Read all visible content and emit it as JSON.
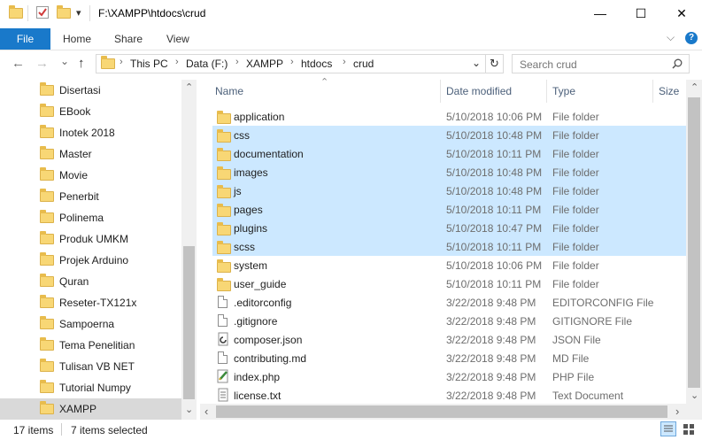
{
  "window": {
    "title": "F:\\XAMPP\\htdocs\\crud",
    "minimize_glyph": "—",
    "maximize_glyph": "☐",
    "close_glyph": "✕"
  },
  "quick_access": {
    "folder_icon": "folder-icon",
    "properties_icon": "properties-check-icon",
    "new_folder_icon": "new-folder-icon",
    "dropdown_glyph": "▾"
  },
  "ribbon": {
    "tabs": [
      "File",
      "Home",
      "Share",
      "View"
    ],
    "expand_glyph": "⌵",
    "help_glyph": "?"
  },
  "navigation": {
    "back_glyph": "←",
    "forward_glyph": "→",
    "recent_glyph": "⌄",
    "up_glyph": "↑",
    "breadcrumbs": [
      "This PC",
      "Data (F:)",
      "XAMPP",
      "htdocs",
      "crud"
    ],
    "separator": "›",
    "dropdown_glyph": "⌄",
    "refresh_glyph": "↻"
  },
  "search": {
    "placeholder": "Search crud",
    "icon": "search-icon"
  },
  "nav_pane": {
    "items": [
      {
        "label": "Disertasi",
        "selected": false
      },
      {
        "label": "EBook",
        "selected": false
      },
      {
        "label": "Inotek 2018",
        "selected": false
      },
      {
        "label": "Master",
        "selected": false
      },
      {
        "label": "Movie",
        "selected": false
      },
      {
        "label": "Penerbit",
        "selected": false
      },
      {
        "label": "Polinema",
        "selected": false
      },
      {
        "label": "Produk UMKM",
        "selected": false
      },
      {
        "label": "Projek Arduino",
        "selected": false
      },
      {
        "label": "Quran",
        "selected": false
      },
      {
        "label": "Reseter-TX121x",
        "selected": false
      },
      {
        "label": "Sampoerna",
        "selected": false
      },
      {
        "label": "Tema Penelitian",
        "selected": false
      },
      {
        "label": "Tulisan VB NET",
        "selected": false
      },
      {
        "label": "Tutorial Numpy",
        "selected": false
      },
      {
        "label": "XAMPP",
        "selected": true
      }
    ]
  },
  "file_list": {
    "columns": [
      "Name",
      "Date modified",
      "Type",
      "Size"
    ],
    "sort_glyph": "⌃",
    "rows": [
      {
        "name": "application",
        "date": "5/10/2018 10:06 PM",
        "type": "File folder",
        "icon": "folder-icon",
        "selected": false
      },
      {
        "name": "css",
        "date": "5/10/2018 10:48 PM",
        "type": "File folder",
        "icon": "folder-icon",
        "selected": true
      },
      {
        "name": "documentation",
        "date": "5/10/2018 10:11 PM",
        "type": "File folder",
        "icon": "folder-icon",
        "selected": true
      },
      {
        "name": "images",
        "date": "5/10/2018 10:48 PM",
        "type": "File folder",
        "icon": "folder-icon",
        "selected": true
      },
      {
        "name": "js",
        "date": "5/10/2018 10:48 PM",
        "type": "File folder",
        "icon": "folder-icon",
        "selected": true
      },
      {
        "name": "pages",
        "date": "5/10/2018 10:11 PM",
        "type": "File folder",
        "icon": "folder-icon",
        "selected": true
      },
      {
        "name": "plugins",
        "date": "5/10/2018 10:47 PM",
        "type": "File folder",
        "icon": "folder-icon",
        "selected": true
      },
      {
        "name": "scss",
        "date": "5/10/2018 10:11 PM",
        "type": "File folder",
        "icon": "folder-icon",
        "selected": true
      },
      {
        "name": "system",
        "date": "5/10/2018 10:06 PM",
        "type": "File folder",
        "icon": "folder-icon",
        "selected": false
      },
      {
        "name": "user_guide",
        "date": "5/10/2018 10:11 PM",
        "type": "File folder",
        "icon": "folder-icon",
        "selected": false
      },
      {
        "name": ".editorconfig",
        "date": "3/22/2018 9:48 PM",
        "type": "EDITORCONFIG File",
        "icon": "file-icon",
        "selected": false
      },
      {
        "name": ".gitignore",
        "date": "3/22/2018 9:48 PM",
        "type": "GITIGNORE File",
        "icon": "file-icon",
        "selected": false
      },
      {
        "name": "composer.json",
        "date": "3/22/2018 9:48 PM",
        "type": "JSON File",
        "icon": "json-file-icon",
        "selected": false
      },
      {
        "name": "contributing.md",
        "date": "3/22/2018 9:48 PM",
        "type": "MD File",
        "icon": "file-icon",
        "selected": false
      },
      {
        "name": "index.php",
        "date": "3/22/2018 9:48 PM",
        "type": "PHP File",
        "icon": "php-file-icon",
        "selected": false
      },
      {
        "name": "license.txt",
        "date": "3/22/2018 9:48 PM",
        "type": "Text Document",
        "icon": "text-file-icon",
        "selected": false
      }
    ]
  },
  "scroll_glyphs": {
    "up": "⌃",
    "down": "⌄",
    "left": "‹",
    "right": "›"
  },
  "status": {
    "item_count": "17 items",
    "selected_count": "7 items selected",
    "details_view_icon": "details-view-icon",
    "large_icons_view_icon": "large-icons-view-icon"
  }
}
